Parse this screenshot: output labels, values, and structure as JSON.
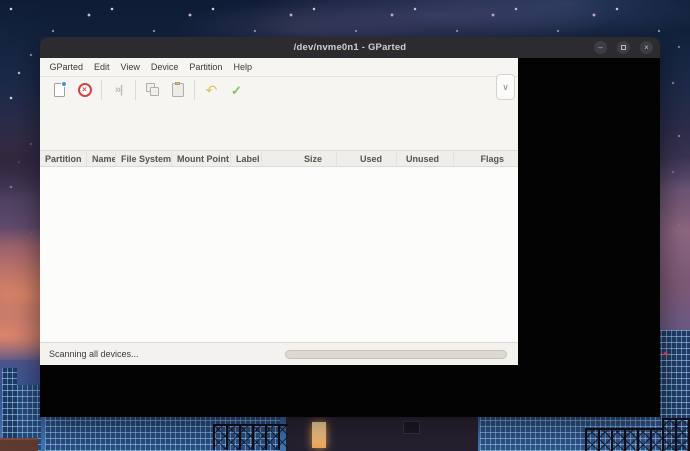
{
  "window": {
    "title": "/dev/nvme0n1 - GParted",
    "controls": {
      "minimize_glyph": "–",
      "close_glyph": "×"
    }
  },
  "menu": {
    "items": [
      "GParted",
      "Edit",
      "View",
      "Device",
      "Partition",
      "Help"
    ]
  },
  "toolbar": {
    "buttons": [
      {
        "name": "new-partition",
        "enabled": true
      },
      {
        "name": "delete-partition",
        "enabled": true
      },
      {
        "name": "resize-move",
        "enabled": false,
        "glyph": "»|"
      },
      {
        "name": "copy",
        "enabled": false
      },
      {
        "name": "paste",
        "enabled": false
      },
      {
        "name": "undo",
        "enabled": false,
        "glyph": "↶"
      },
      {
        "name": "apply",
        "enabled": true,
        "glyph": "✓"
      }
    ],
    "overflow_glyph": "∨"
  },
  "table": {
    "columns": [
      "Partition",
      "Name",
      "File System",
      "Mount Point",
      "Label",
      "Size",
      "Used",
      "Unused",
      "Flags"
    ],
    "rows": []
  },
  "statusbar": {
    "text": "Scanning all devices...",
    "progress_percent": 0
  },
  "colors": {
    "titlebar": "#2c2c30",
    "client_bg": "#f6f5f2",
    "window_void": "#030303",
    "delete_red": "#cf4545",
    "apply_green": "#84c25f",
    "undo_yellow": "#d9c261",
    "new_badge_blue": "#4a90d9"
  }
}
